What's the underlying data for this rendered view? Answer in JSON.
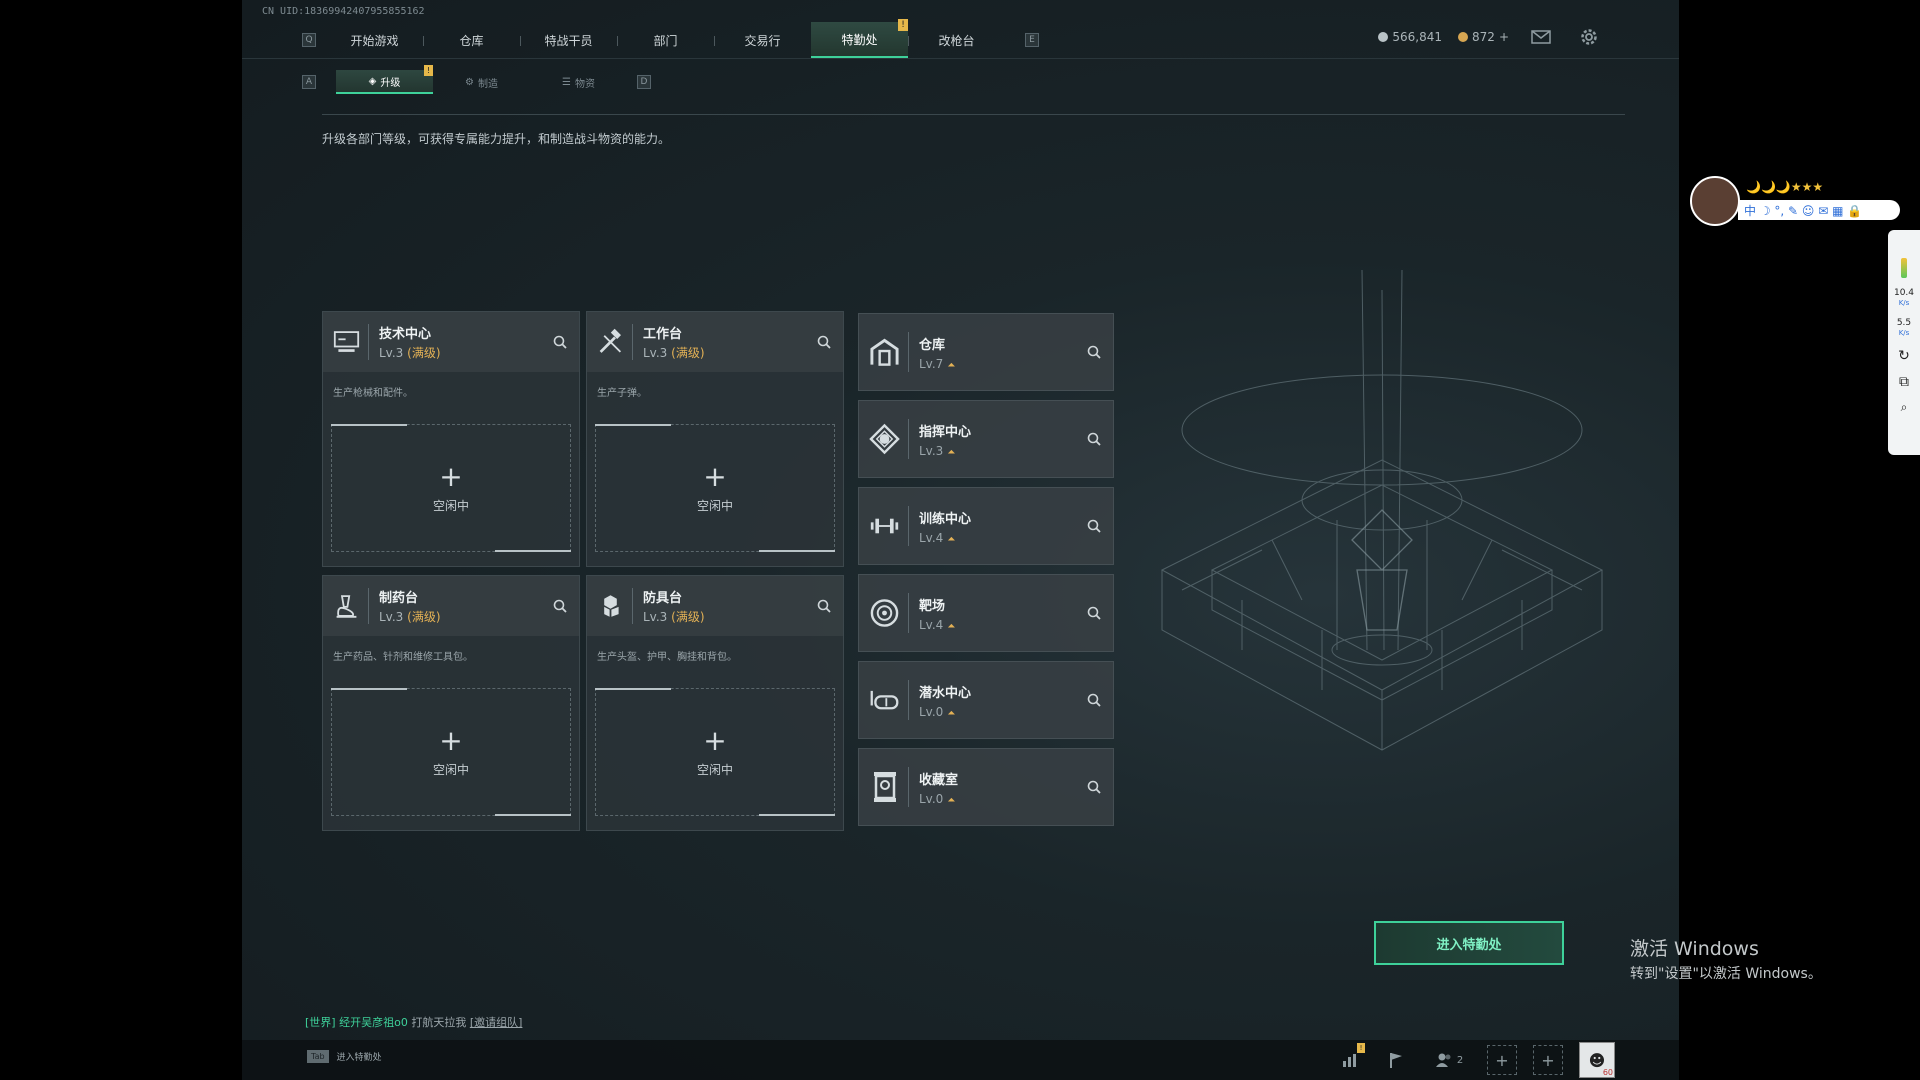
{
  "uid": "CN UID:18369942407955855162",
  "nav": {
    "key_left": "Q",
    "key_right": "E",
    "tabs": [
      {
        "label": "开始游戏"
      },
      {
        "label": "仓库"
      },
      {
        "label": "特战干员"
      },
      {
        "label": "部门"
      },
      {
        "label": "交易行"
      },
      {
        "label": "特勤处",
        "active": true,
        "alert": "!"
      },
      {
        "label": "改枪台"
      }
    ]
  },
  "currency": {
    "silver": "566,841",
    "gold": "872",
    "gold_plus": "+"
  },
  "top_icons": [
    "mail-icon",
    "gear-icon"
  ],
  "subnav": {
    "key_left": "A",
    "key_right": "D",
    "tabs": [
      {
        "label": "升级",
        "active": true,
        "alert": "!"
      },
      {
        "label": "制造"
      },
      {
        "label": "物资"
      }
    ]
  },
  "description": "升级各部门等级，可获得专属能力提升，和制造战斗物资的能力。",
  "workstations": [
    {
      "name": "技术中心",
      "lv_prefix": "Lv.3",
      "lv_max": "(满级)",
      "desc": "生产枪械和配件。",
      "status": "空闲中",
      "icon": "computer-icon"
    },
    {
      "name": "工作台",
      "lv_prefix": "Lv.3",
      "lv_max": "(满级)",
      "desc": "生产子弹。",
      "status": "空闲中",
      "icon": "hammer-icon"
    },
    {
      "name": "制药台",
      "lv_prefix": "Lv.3",
      "lv_max": "(满级)",
      "desc": "生产药品、针剂和维修工具包。",
      "status": "空闲中",
      "icon": "microscope-icon"
    },
    {
      "name": "防具台",
      "lv_prefix": "Lv.3",
      "lv_max": "(满级)",
      "desc": "生产头盔、护甲、胸挂和背包。",
      "status": "空闲中",
      "icon": "armor-icon"
    }
  ],
  "departments": [
    {
      "name": "仓库",
      "lv": "Lv.7",
      "icon": "warehouse-icon"
    },
    {
      "name": "指挥中心",
      "lv": "Lv.3",
      "icon": "command-icon"
    },
    {
      "name": "训练中心",
      "lv": "Lv.4",
      "icon": "dumbbell-icon"
    },
    {
      "name": "靶场",
      "lv": "Lv.4",
      "icon": "target-icon"
    },
    {
      "name": "潜水中心",
      "lv": "Lv.0",
      "icon": "diving-mask-icon"
    },
    {
      "name": "收藏室",
      "lv": "Lv.0",
      "icon": "trophy-case-icon"
    }
  ],
  "enter_button": "进入特勤处",
  "chat": {
    "channel": "[世界]",
    "user": "经开吴彦祖o0",
    "message": "打航天拉我",
    "link": "[邀请组队]"
  },
  "bottom": {
    "tab_key": "Tab",
    "tab_label": "进入特勤处",
    "friends_count": "2",
    "avatar_level": "60"
  },
  "watermark": {
    "line1": "激活 Windows",
    "line2": "转到\"设置\"以激活 Windows。"
  },
  "overlay": {
    "stars": "🌙🌙🌙★★★",
    "bar_text": "中 ☽ °, ✎ ☺ ✉ ▦ 🔒"
  },
  "side_panel": {
    "net_up": "10.4",
    "net_up_unit": "K/s",
    "net_down": "5.5",
    "net_down_unit": "K/s"
  },
  "colors": {
    "accent": "#3ed19a",
    "max_level": "#e3b155",
    "alert": "#e6b84a"
  }
}
